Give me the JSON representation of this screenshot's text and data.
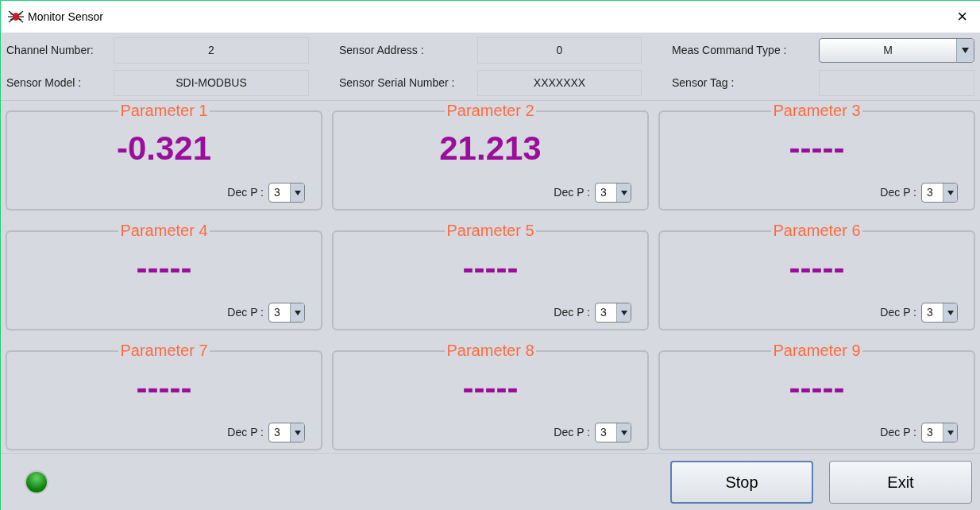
{
  "window": {
    "title": "Monitor Sensor",
    "close": "×"
  },
  "fields": [
    {
      "label": "Channel Number:",
      "value": "2",
      "kind": "text"
    },
    {
      "label": "Sensor Address :",
      "value": "0",
      "kind": "text"
    },
    {
      "label": "Meas Command Type :",
      "value": "M",
      "kind": "dropdown"
    },
    {
      "label": "Sensor Model :",
      "value": "SDI-MODBUS",
      "kind": "text"
    },
    {
      "label": "Sensor Serial Number :",
      "value": "XXXXXXX",
      "kind": "text"
    },
    {
      "label": "Sensor Tag :",
      "kind": "text"
    }
  ],
  "parameters": [
    {
      "title": "Parameter 1",
      "value": "-0.321",
      "dec_label": "Dec P :",
      "dec": "3"
    },
    {
      "title": "Parameter 2",
      "value": "21.213",
      "dec_label": "Dec P :",
      "dec": "3"
    },
    {
      "title": "Parameter 3",
      "value": "-----",
      "dec_label": "Dec P :",
      "dec": "3"
    },
    {
      "title": "Parameter 4",
      "value": "-----",
      "dec_label": "Dec P :",
      "dec": "3"
    },
    {
      "title": "Parameter 5",
      "value": "-----",
      "dec_label": "Dec P :",
      "dec": "3"
    },
    {
      "title": "Parameter 6",
      "value": "-----",
      "dec_label": "Dec P :",
      "dec": "3"
    },
    {
      "title": "Parameter 7",
      "value": "-----",
      "dec_label": "Dec P :",
      "dec": "3"
    },
    {
      "title": "Parameter 8",
      "value": "-----",
      "dec_label": "Dec P :",
      "dec": "3"
    },
    {
      "title": "Parameter 9",
      "value": "-----",
      "dec_label": "Dec P :",
      "dec": "3"
    }
  ],
  "status_light": {
    "on": true
  },
  "buttons": [
    {
      "label": "Stop",
      "focused": true
    },
    {
      "label": "Exit",
      "focused": false
    }
  ]
}
